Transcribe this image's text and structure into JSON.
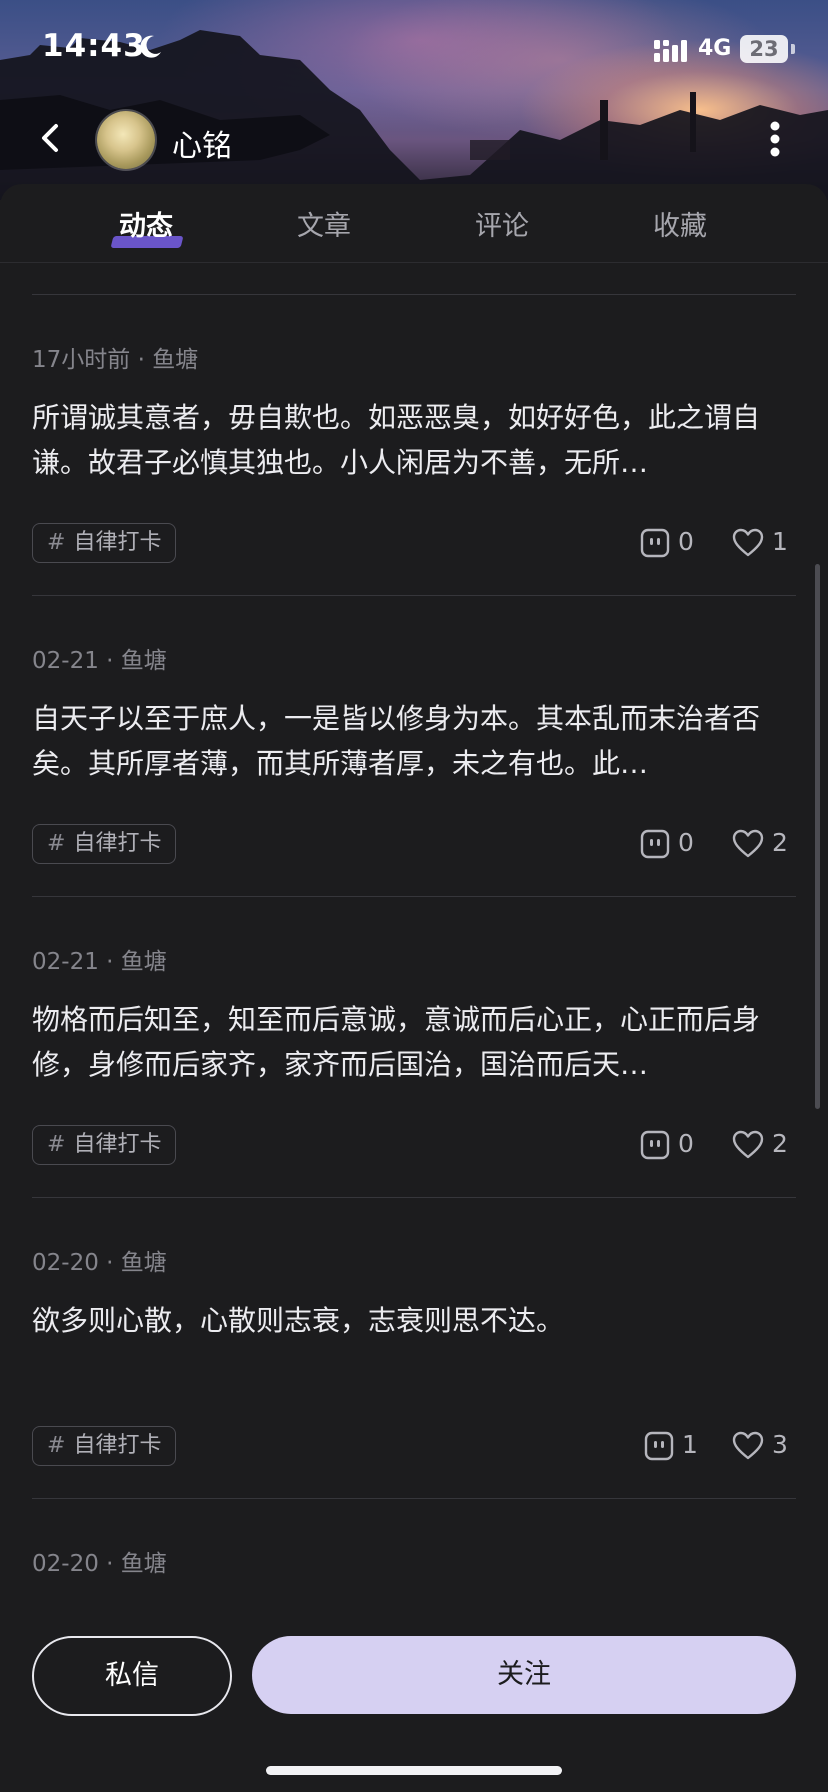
{
  "status_bar": {
    "time": "14:43",
    "network": "4G",
    "battery": "23"
  },
  "header": {
    "profile_name": "心铭"
  },
  "tabs": [
    {
      "label": "动态",
      "active": true
    },
    {
      "label": "文章",
      "active": false
    },
    {
      "label": "评论",
      "active": false
    },
    {
      "label": "收藏",
      "active": false
    }
  ],
  "posts": [
    {
      "time": "17小时前",
      "source": "鱼塘",
      "text": "所谓诚其意者，毋自欺也。如恶恶臭，如好好色，此之谓自谦。故君子必慎其独也。小人闲居为不善，无所…",
      "tag": "自律打卡",
      "comments": "0",
      "likes": "1"
    },
    {
      "time": "02-21",
      "source": "鱼塘",
      "text": "自天子以至于庶人，一是皆以修身为本。其本乱而末治者否矣。其所厚者薄，而其所薄者厚，未之有也。此…",
      "tag": "自律打卡",
      "comments": "0",
      "likes": "2"
    },
    {
      "time": "02-21",
      "source": "鱼塘",
      "text": "物格而后知至，知至而后意诚，意诚而后心正，心正而后身修，身修而后家齐，家齐而后国治，国治而后天…",
      "tag": "自律打卡",
      "comments": "0",
      "likes": "2"
    },
    {
      "time": "02-20",
      "source": "鱼塘",
      "text": "欲多则心散，心散则志衰，志衰则思不达。",
      "tag": "自律打卡",
      "comments": "1",
      "likes": "3"
    },
    {
      "time": "02-20",
      "source": "鱼塘"
    }
  ],
  "bottom_bar": {
    "message_label": "私信",
    "follow_label": "关注"
  },
  "colors": {
    "background": "#1c1c1e",
    "accent": "#6a55c9",
    "follow_button": "#d6d0f2"
  },
  "icons": [
    "moon-icon",
    "signal-icon",
    "back-icon",
    "more-icon",
    "comment-icon",
    "heart-icon"
  ]
}
